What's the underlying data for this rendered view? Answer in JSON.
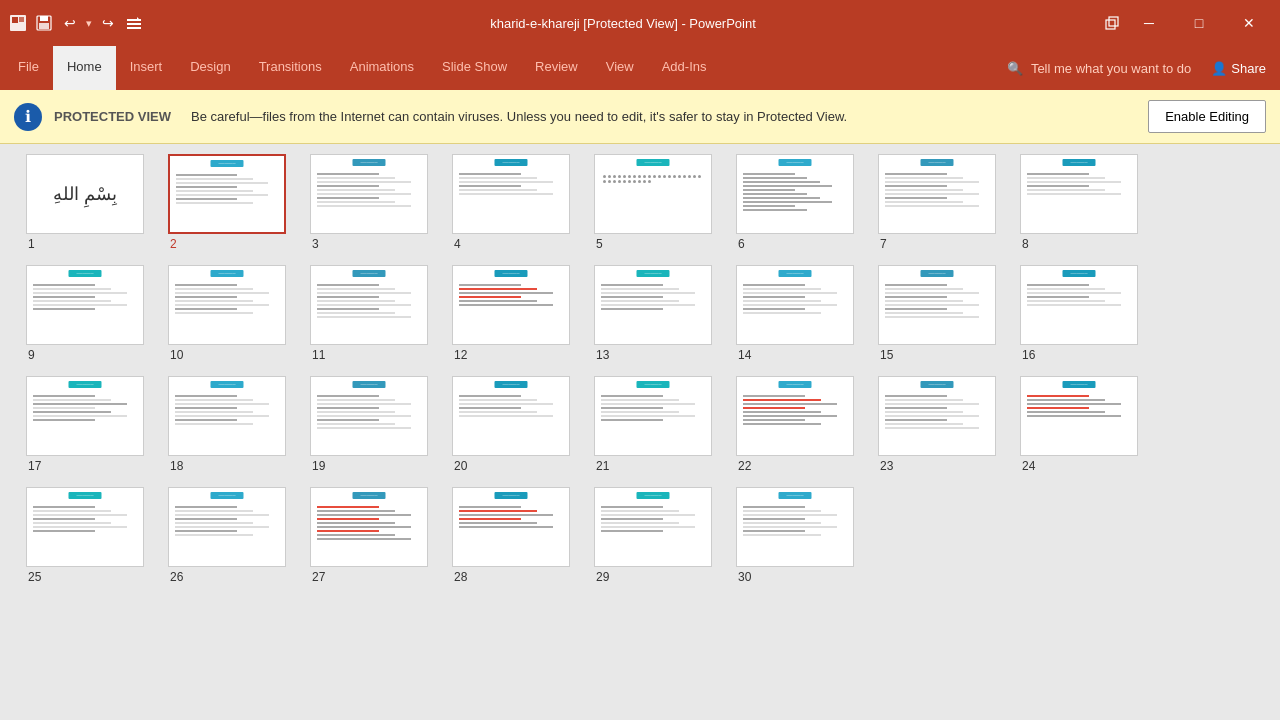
{
  "titleBar": {
    "appIcon": "■",
    "undoIcon": "↩",
    "redoIcon": "↪",
    "title": "kharid-e-khareji [Protected View] - PowerPoint",
    "minimizeIcon": "─",
    "maximizeIcon": "□",
    "closeIcon": "✕"
  },
  "ribbon": {
    "tabs": [
      "File",
      "Home",
      "Insert",
      "Design",
      "Transitions",
      "Animations",
      "Slide Show",
      "Review",
      "View",
      "Add-Ins"
    ],
    "activeTab": "Home",
    "search": "Tell me what you want to do",
    "share": "Share"
  },
  "protectedView": {
    "icon": "ℹ",
    "label": "PROTECTED VIEW",
    "message": "Be careful—files from the Internet can contain viruses. Unless you need to edit, it's safer to stay in Protected View.",
    "buttonLabel": "Enable Editing"
  },
  "slides": [
    {
      "number": 1,
      "type": "arabic-calligraphy"
    },
    {
      "number": 2,
      "type": "selected"
    },
    {
      "number": 3,
      "type": "text"
    },
    {
      "number": 4,
      "type": "text"
    },
    {
      "number": 5,
      "type": "dots"
    },
    {
      "number": 6,
      "type": "text-heavy"
    },
    {
      "number": 7,
      "type": "text"
    },
    {
      "number": 8,
      "type": "text"
    },
    {
      "number": 9,
      "type": "text"
    },
    {
      "number": 10,
      "type": "text"
    },
    {
      "number": 11,
      "type": "text"
    },
    {
      "number": 12,
      "type": "text-red"
    },
    {
      "number": 13,
      "type": "text"
    },
    {
      "number": 14,
      "type": "text"
    },
    {
      "number": 15,
      "type": "text"
    },
    {
      "number": 16,
      "type": "text"
    },
    {
      "number": 17,
      "type": "text-special"
    },
    {
      "number": 18,
      "type": "text"
    },
    {
      "number": 19,
      "type": "text"
    },
    {
      "number": 20,
      "type": "text"
    },
    {
      "number": 21,
      "type": "text"
    },
    {
      "number": 22,
      "type": "text-red2"
    },
    {
      "number": 23,
      "type": "text"
    },
    {
      "number": 24,
      "type": "text-colored"
    },
    {
      "number": 25,
      "type": "text"
    },
    {
      "number": 26,
      "type": "text"
    },
    {
      "number": 27,
      "type": "text-colored2"
    },
    {
      "number": 28,
      "type": "text-red3"
    },
    {
      "number": 29,
      "type": "text"
    },
    {
      "number": 30,
      "type": "text"
    }
  ]
}
